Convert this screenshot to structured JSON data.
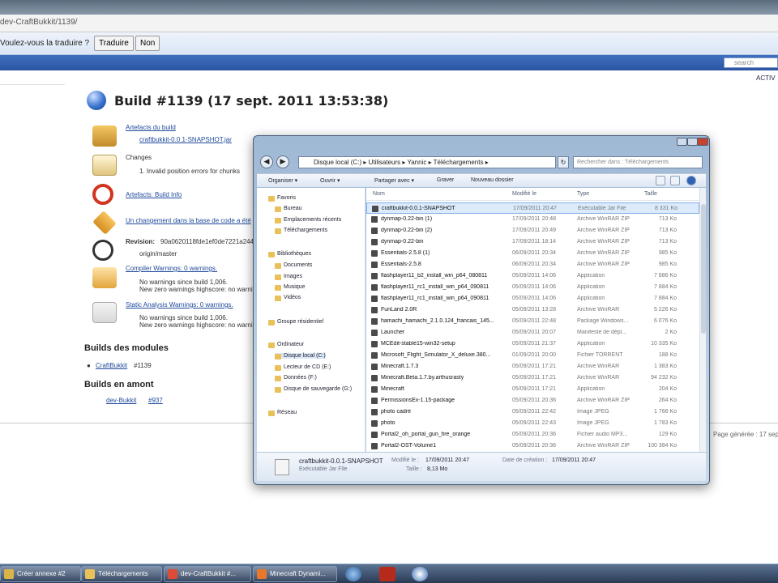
{
  "browser": {
    "url": "dev-CraftBukkit/1139/",
    "translate_question": "Voulez-vous la traduire ?",
    "translate_button": "Traduire",
    "no_button": "Non",
    "search_placeholder": "search",
    "logout": "ACTIV"
  },
  "jenkins": {
    "title": "Build #1139 (17 sept. 2011 13:53:38)",
    "artifacts_link": "Artefacts du build",
    "artifact_file": "craftbukkit-0.0.1-SNAPSHOT.jar",
    "changes_label": "Changes",
    "change_item": "1.  Invalid position errors for chunks",
    "fingerprints_link": "Artefacts: Build Info",
    "scm_change": "Un changement dans la base de code a été",
    "revision_label": "Revision:",
    "revision_value": "90a0620118fde1ef0de7221a244",
    "branch": "origin/master",
    "compiler_warnings": "Compiler Warnings: 0 warnings.",
    "cw_line1": "No warnings since build 1,006.",
    "cw_line2": "New zero warnings highscore: no warnings",
    "static_analysis": "Static Analysis Warnings: 0 warnings.",
    "sa_line1": "No warnings since build 1,006.",
    "sa_line2": "New zero warnings highscore: no warnings",
    "modules_heading": "Builds des modules",
    "module_link": "CraftBukkit",
    "module_build": "#1139",
    "upstream_heading": "Builds en amont",
    "upstream_link": "dev-Bukkit",
    "upstream_build": "#937",
    "page_generated": "Page générée : 17 sept."
  },
  "explorer": {
    "address": "Disque local (C:)  ▸  Utilisateurs  ▸  Yannic  ▸  Téléchargements  ▸",
    "search_placeholder": "Rechercher dans : Téléchargements",
    "toolbar": {
      "organize": "Organiser ▾",
      "open": "Ouvrir ▾",
      "share": "Partager avec ▾",
      "burn": "Graver",
      "new_folder": "Nouveau dossier"
    },
    "nav": {
      "favorites": "Favoris",
      "desktop": "Bureau",
      "recent": "Emplacements récents",
      "downloads": "Téléchargements",
      "libraries": "Bibliothèques",
      "documents": "Documents",
      "images": "Images",
      "music": "Musique",
      "videos": "Vidéos",
      "homegroup": "Groupe résidentiel",
      "computer": "Ordinateur",
      "local_disk": "Disque local (C:)",
      "cd_drive": "Lecteur de CD (E:)",
      "data": "Données (F:)",
      "backup": "Disque de sauvegarde (G:)",
      "network": "Réseau"
    },
    "columns": {
      "name": "Nom",
      "modified": "Modifié le",
      "type": "Type",
      "size": "Taille"
    },
    "files": [
      {
        "name": "craftbukkit-0.0.1-SNAPSHOT",
        "date": "17/09/2011 20:47",
        "type": "Exécutable Jar File",
        "size": "8 331 Ko"
      },
      {
        "name": "dynmap-0.22-bin (1)",
        "date": "17/09/2011 20:48",
        "type": "Archive WinRAR ZIP",
        "size": "713 Ko"
      },
      {
        "name": "dynmap-0.22-bin (2)",
        "date": "17/09/2011 20:49",
        "type": "Archive WinRAR ZIP",
        "size": "713 Ko"
      },
      {
        "name": "dynmap-0.22-bin",
        "date": "17/09/2011 18:14",
        "type": "Archive WinRAR ZIP",
        "size": "713 Ko"
      },
      {
        "name": "Essentials-2.5.8 (1)",
        "date": "06/09/2011 20:34",
        "type": "Archive WinRAR ZIP",
        "size": "985 Ko"
      },
      {
        "name": "Essentials-2.5.8",
        "date": "06/09/2011 20:34",
        "type": "Archive WinRAR ZIP",
        "size": "985 Ko"
      },
      {
        "name": "flashplayer11_b2_install_win_p64_080811",
        "date": "05/09/2011 14:06",
        "type": "Application",
        "size": "7 886 Ko"
      },
      {
        "name": "flashplayer11_rc1_install_win_p64_090811",
        "date": "05/09/2011 14:06",
        "type": "Application",
        "size": "7 884 Ko"
      },
      {
        "name": "flashplayer11_rc1_install_win_p64_090811",
        "date": "05/09/2011 14:06",
        "type": "Application",
        "size": "7 884 Ko"
      },
      {
        "name": "FunLand 2.0R",
        "date": "05/09/2011 13:28",
        "type": "Archive WinRAR",
        "size": "5 226 Ko"
      },
      {
        "name": "hamachi_hamachi_2.1.0.124_francais_145...",
        "date": "05/09/2011 22:48",
        "type": "Package Windows...",
        "size": "6 076 Ko"
      },
      {
        "name": "Launcher",
        "date": "05/09/2011 20:07",
        "type": "Manifeste de dépl...",
        "size": "2 Ko"
      },
      {
        "name": "MCEdit-stable15-win32-setup",
        "date": "05/09/2011 21:37",
        "type": "Application",
        "size": "10 335 Ko"
      },
      {
        "name": "Microsoft_Flight_Simulator_X_deluxe.380...",
        "date": "01/09/2011 20:00",
        "type": "Fichier TORRENT",
        "size": "188 Ko"
      },
      {
        "name": "Minecraft.1.7.3",
        "date": "05/09/2011 17:21",
        "type": "Archive WinRAR",
        "size": "1 383 Ko"
      },
      {
        "name": "Minecraft.Beta.1.7.by.arthusrasty",
        "date": "05/09/2011 17:21",
        "type": "Archive WinRAR",
        "size": "94 232 Ko"
      },
      {
        "name": "Minecraft",
        "date": "05/09/2011 17:21",
        "type": "Application",
        "size": "204 Ko"
      },
      {
        "name": "PermissionsEx-1.15-package",
        "date": "05/09/2011 20:36",
        "type": "Archive WinRAR ZIP",
        "size": "264 Ko"
      },
      {
        "name": "photo cadré",
        "date": "05/09/2011 22:42",
        "type": "Image JPEG",
        "size": "1 766 Ko"
      },
      {
        "name": "photo",
        "date": "05/09/2011 22:43",
        "type": "Image JPEG",
        "size": "1 783 Ko"
      },
      {
        "name": "Portal2_oh_portal_gun_fire_orange",
        "date": "05/09/2011 20:36",
        "type": "Fichier audio MP3...",
        "size": "129 Ko"
      },
      {
        "name": "Portal2-OST-Volume1",
        "date": "05/09/2011 20:36",
        "type": "Archive WinRAR ZIP",
        "size": "100 384 Ko"
      }
    ],
    "details": {
      "name": "craftbukkit-0.0.1-SNAPSHOT",
      "type": "Exécutable Jar File",
      "modified_label": "Modifié le :",
      "modified_value": "17/09/2011 20:47",
      "size_label": "Taille :",
      "size_value": "8,13 Mo",
      "created_label": "Date de création :",
      "created_value": "17/09/2011 20:47"
    }
  },
  "taskbar": {
    "items": [
      {
        "label": "Créer annexe #2",
        "color": "#d9b44a"
      },
      {
        "label": "Téléchargements",
        "color": "#e9c15a"
      },
      {
        "label": "dev-CraftBukkit #...",
        "color": "#dd4b39"
      },
      {
        "label": "Minecraft Dynami...",
        "color": "#e8772c"
      }
    ]
  }
}
